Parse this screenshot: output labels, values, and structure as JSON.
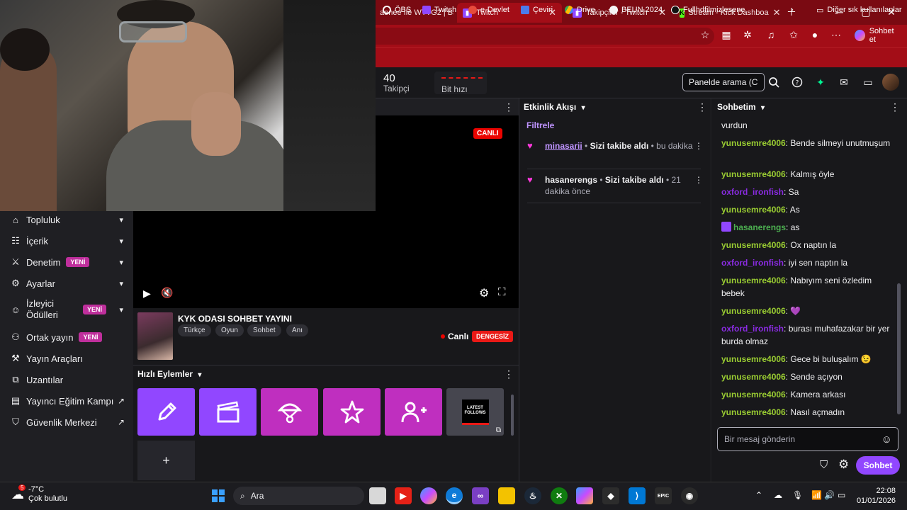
{
  "browser": {
    "tabs": [
      {
        "label": "aenee İle WTTG2 | Ba",
        "active": false
      },
      {
        "label": "Twitch",
        "active": true
      },
      {
        "label": "Takipçiler - Twitch",
        "active": false
      },
      {
        "label": "Stream - Kick Dashboa",
        "active": false
      }
    ],
    "copilot_label": "Sohbet et",
    "bookmarks": [
      "ÖBS",
      "Twitch",
      "e-Devlet",
      "Çeviri",
      "Drive",
      "BEUN 2024",
      "Fullhdfilmizlesene"
    ],
    "bookmarks_other": "Diğer sık kullanılanlar"
  },
  "topbar": {
    "followers_count": "40",
    "followers_label": "Takipçi",
    "bitrate_label": "Bit hızı",
    "search_placeholder": "Panelde arama (C"
  },
  "leftnav": {
    "items": [
      {
        "label": "Topluluk",
        "badge": ""
      },
      {
        "label": "İçerik",
        "badge": ""
      },
      {
        "label": "Denetim",
        "badge": "YENİ"
      },
      {
        "label": "Ayarlar",
        "badge": ""
      },
      {
        "label": "İzleyici Ödülleri",
        "badge": "YENİ"
      },
      {
        "label": "Ortak yayın",
        "badge": "YENİ"
      },
      {
        "label": "Yayın Araçları",
        "badge": ""
      },
      {
        "label": "Uzantılar",
        "badge": ""
      },
      {
        "label": "Yayıncı Eğitim Kampı",
        "badge": ""
      },
      {
        "label": "Güvenlik Merkezi",
        "badge": ""
      }
    ]
  },
  "stream": {
    "live_badge": "CANLI",
    "title": "KYK ODASI SOHBET YAYINI",
    "tags": [
      "Türkçe",
      "Oyun",
      "Sohbet",
      "Anı"
    ],
    "status": "Canlı",
    "health": "DENGESİZ"
  },
  "quick_actions": {
    "title": "Hızlı Eylemler",
    "latest_follows": "LATEST FOLLOWS",
    "tiles": [
      "pencil-icon",
      "clapper-icon",
      "parachute-icon",
      "star-icon",
      "add-user-icon"
    ],
    "colors": {
      "purple": "#9147ff",
      "magenta": "#bf2fbf"
    }
  },
  "activity": {
    "title": "Etkinlik Akışı",
    "filter": "Filtrele",
    "items": [
      {
        "user": "minasarii",
        "text": "Sizi takibe aldı",
        "time": "bu dakika"
      },
      {
        "user": "hasanerengs",
        "text": "Sizi takibe aldı",
        "time": "21 dakika önce"
      }
    ]
  },
  "chat": {
    "title": "Sohbetim",
    "messages": [
      {
        "user": "",
        "text": "vurdun",
        "color": "green"
      },
      {
        "user": "yunusemre4006",
        "text": "Bende silmeyi unutmuşum",
        "color": "green"
      },
      {
        "user": "yunusemre4006",
        "text": "Kalmış öyle",
        "color": "green"
      },
      {
        "user": "oxford_ironfish",
        "text": "Sa",
        "color": "purple"
      },
      {
        "user": "yunusemre4006",
        "text": "As",
        "color": "green"
      },
      {
        "user": "hasanerengs",
        "text": "as",
        "color": "green2"
      },
      {
        "user": "yunusemre4006",
        "text": "Ox naptın la",
        "color": "green"
      },
      {
        "user": "oxford_ironfish",
        "text": "iyi sen naptın la",
        "color": "purple"
      },
      {
        "user": "yunusemre4006",
        "text": "Nabıyım seni özledim bebek",
        "color": "green"
      },
      {
        "user": "yunusemre4006",
        "text": "💜",
        "color": "green"
      },
      {
        "user": "oxford_ironfish",
        "text": "burası muhafazakar bir yer burda olmaz",
        "color": "purple"
      },
      {
        "user": "yunusemre4006",
        "text": "Gece bi buluşalım 😉",
        "color": "green"
      },
      {
        "user": "yunusemre4006",
        "text": "Sende açıyon",
        "color": "green"
      },
      {
        "user": "yunusemre4006",
        "text": "Kamera arkası",
        "color": "green"
      },
      {
        "user": "yunusemre4006",
        "text": "Nasıl açmadın",
        "color": "green"
      }
    ],
    "input_placeholder": "Bir mesaj gönderin",
    "send_label": "Sohbet"
  },
  "taskbar": {
    "temp": "-7°C",
    "weather": "Çok bulutlu",
    "weather_badge": "5",
    "search_label": "Ara",
    "time": "22:08",
    "date": "01/01/2026"
  }
}
